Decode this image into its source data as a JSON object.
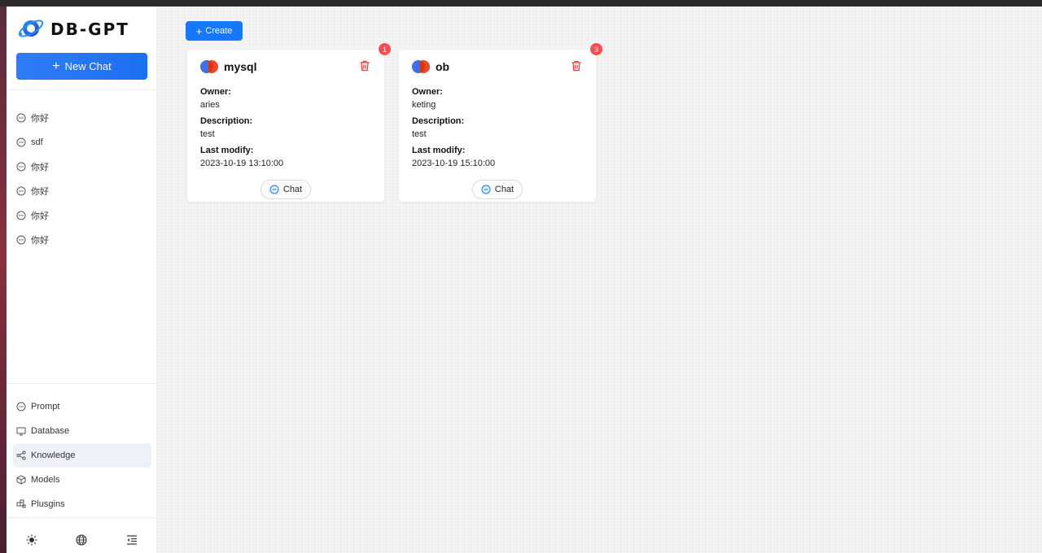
{
  "app": {
    "logo_text": "DB-GPT"
  },
  "sidebar": {
    "new_chat_label": "New Chat",
    "conversations": [
      "你好",
      "sdf",
      "你好",
      "你好",
      "你好",
      "你好"
    ],
    "menu": [
      {
        "label": "Prompt",
        "icon": "chat-bubble-icon",
        "active": false
      },
      {
        "label": "Database",
        "icon": "monitor-icon",
        "active": false
      },
      {
        "label": "Knowledge",
        "icon": "share-nodes-icon",
        "active": true
      },
      {
        "label": "Models",
        "icon": "cube-icon",
        "active": false
      },
      {
        "label": "Plusgins",
        "icon": "puzzle-icon",
        "active": false
      }
    ],
    "bottom_icons": [
      "sun-icon",
      "globe-icon",
      "collapse-menu-icon"
    ]
  },
  "main": {
    "create_label": "Create",
    "cards": [
      {
        "name": "mysql",
        "badge": "1",
        "owner_label": "Owner:",
        "owner": "aries",
        "description_label": "Description:",
        "description": "test",
        "last_modify_label": "Last modify:",
        "last_modify": "2023-10-19 13:10:00",
        "chat_label": "Chat"
      },
      {
        "name": "ob",
        "badge": "3",
        "owner_label": "Owner:",
        "owner": "keting",
        "description_label": "Description:",
        "description": "test",
        "last_modify_label": "Last modify:",
        "last_modify": "2023-10-19 15:10:00",
        "chat_label": "Chat"
      }
    ]
  },
  "colors": {
    "primary": "#1677ff",
    "danger": "#ff4d4f",
    "trash": "#e53935"
  }
}
